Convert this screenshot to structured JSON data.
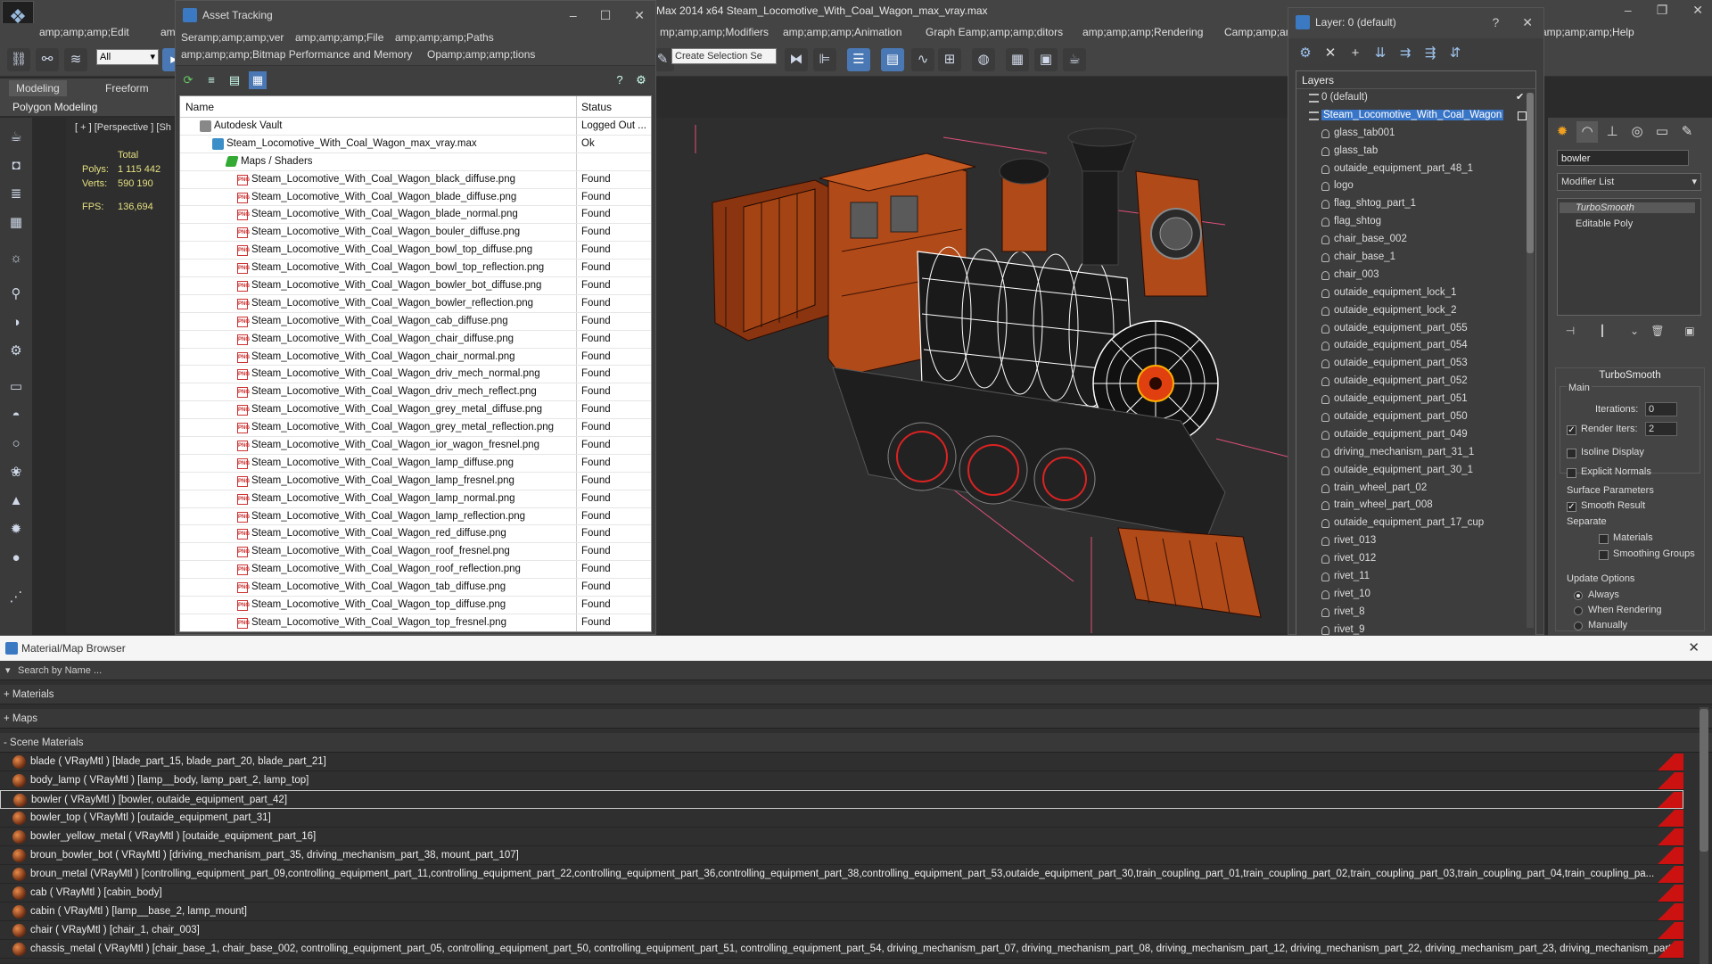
{
  "app": {
    "title": "Max  2014 x64     Steam_Locomotive_With_Coal_Wagon_max_vray.max",
    "logo": "max-logo",
    "window_controls": [
      "–",
      "❐",
      "✕"
    ]
  },
  "menubar": {
    "items": [
      "amp;amp;amp;Edit",
      "am",
      "mp;amp;amp;Modifiers",
      "amp;amp;amp;Animation",
      "Graph Eamp;amp;amp;ditors",
      "amp;amp;amp;Rendering",
      "Camp;amp;amp;ustomize",
      "amp;amp;amp;Help"
    ]
  },
  "toolbar": {
    "filter_value": "All",
    "selection_set_placeholder": "Create Selection Se"
  },
  "ribbon": {
    "tabs": [
      "Modeling",
      "Freeform"
    ],
    "subtitle": "Polygon Modeling"
  },
  "viewport": {
    "label": "[ + ] [Perspective ] [Sh",
    "stats": {
      "total_label": "Total",
      "polys_label": "Polys:",
      "polys_value": "1 115 442",
      "verts_label": "Verts:",
      "verts_value": "590 190",
      "fps_label": "FPS:",
      "fps_value": "136,694"
    }
  },
  "asset_tracking": {
    "title": "Asset Tracking",
    "menus": [
      "Seramp;amp;amp;ver",
      "amp;amp;amp;File",
      "amp;amp;amp;Paths",
      "amp;amp;amp;Bitmap Performance and Memory",
      "Opamp;amp;amp;tions"
    ],
    "columns": {
      "name": "Name",
      "status": "Status"
    },
    "rows": [
      {
        "name": "Autodesk Vault",
        "status": "Logged Out ...",
        "icon": "vault",
        "indent": 1
      },
      {
        "name": "Steam_Locomotive_With_Coal_Wagon_max_vray.max",
        "status": "Ok",
        "icon": "max",
        "indent": 2
      },
      {
        "name": "Maps / Shaders",
        "status": "",
        "icon": "maps",
        "indent": 3
      },
      {
        "name": "Steam_Locomotive_With_Coal_Wagon_black_diffuse.png",
        "status": "Found",
        "icon": "png",
        "indent": 4
      },
      {
        "name": "Steam_Locomotive_With_Coal_Wagon_blade_diffuse.png",
        "status": "Found",
        "icon": "png",
        "indent": 4
      },
      {
        "name": "Steam_Locomotive_With_Coal_Wagon_blade_normal.png",
        "status": "Found",
        "icon": "png",
        "indent": 4
      },
      {
        "name": "Steam_Locomotive_With_Coal_Wagon_bouler_diffuse.png",
        "status": "Found",
        "icon": "png",
        "indent": 4
      },
      {
        "name": "Steam_Locomotive_With_Coal_Wagon_bowl_top_diffuse.png",
        "status": "Found",
        "icon": "png",
        "indent": 4
      },
      {
        "name": "Steam_Locomotive_With_Coal_Wagon_bowl_top_reflection.png",
        "status": "Found",
        "icon": "png",
        "indent": 4
      },
      {
        "name": "Steam_Locomotive_With_Coal_Wagon_bowler_bot_diffuse.png",
        "status": "Found",
        "icon": "png",
        "indent": 4
      },
      {
        "name": "Steam_Locomotive_With_Coal_Wagon_bowler_reflection.png",
        "status": "Found",
        "icon": "png",
        "indent": 4
      },
      {
        "name": "Steam_Locomotive_With_Coal_Wagon_cab_diffuse.png",
        "status": "Found",
        "icon": "png",
        "indent": 4
      },
      {
        "name": "Steam_Locomotive_With_Coal_Wagon_chair_diffuse.png",
        "status": "Found",
        "icon": "png",
        "indent": 4
      },
      {
        "name": "Steam_Locomotive_With_Coal_Wagon_chair_normal.png",
        "status": "Found",
        "icon": "png",
        "indent": 4
      },
      {
        "name": "Steam_Locomotive_With_Coal_Wagon_driv_mech_normal.png",
        "status": "Found",
        "icon": "png",
        "indent": 4
      },
      {
        "name": "Steam_Locomotive_With_Coal_Wagon_driv_mech_reflect.png",
        "status": "Found",
        "icon": "png",
        "indent": 4
      },
      {
        "name": "Steam_Locomotive_With_Coal_Wagon_grey_metal_diffuse.png",
        "status": "Found",
        "icon": "png",
        "indent": 4
      },
      {
        "name": "Steam_Locomotive_With_Coal_Wagon_grey_metal_reflection.png",
        "status": "Found",
        "icon": "png",
        "indent": 4
      },
      {
        "name": "Steam_Locomotive_With_Coal_Wagon_ior_wagon_fresnel.png",
        "status": "Found",
        "icon": "png",
        "indent": 4
      },
      {
        "name": "Steam_Locomotive_With_Coal_Wagon_lamp_diffuse.png",
        "status": "Found",
        "icon": "png",
        "indent": 4
      },
      {
        "name": "Steam_Locomotive_With_Coal_Wagon_lamp_fresnel.png",
        "status": "Found",
        "icon": "png",
        "indent": 4
      },
      {
        "name": "Steam_Locomotive_With_Coal_Wagon_lamp_normal.png",
        "status": "Found",
        "icon": "png",
        "indent": 4
      },
      {
        "name": "Steam_Locomotive_With_Coal_Wagon_lamp_reflection.png",
        "status": "Found",
        "icon": "png",
        "indent": 4
      },
      {
        "name": "Steam_Locomotive_With_Coal_Wagon_red_diffuse.png",
        "status": "Found",
        "icon": "png",
        "indent": 4
      },
      {
        "name": "Steam_Locomotive_With_Coal_Wagon_roof_fresnel.png",
        "status": "Found",
        "icon": "png",
        "indent": 4
      },
      {
        "name": "Steam_Locomotive_With_Coal_Wagon_roof_reflection.png",
        "status": "Found",
        "icon": "png",
        "indent": 4
      },
      {
        "name": "Steam_Locomotive_With_Coal_Wagon_tab_diffuse.png",
        "status": "Found",
        "icon": "png",
        "indent": 4
      },
      {
        "name": "Steam_Locomotive_With_Coal_Wagon_top_diffuse.png",
        "status": "Found",
        "icon": "png",
        "indent": 4
      },
      {
        "name": "Steam_Locomotive_With_Coal_Wagon_top_fresnel.png",
        "status": "Found",
        "icon": "png",
        "indent": 4
      }
    ]
  },
  "layer_dialog": {
    "title": "Layer: 0 (default)",
    "help": "?",
    "panel_title": "Layers",
    "rows": [
      {
        "name": "0 (default)",
        "type": "layer",
        "indent": 1,
        "check": "✔"
      },
      {
        "name": "Steam_Locomotive_With_Coal_Wagon",
        "type": "layer",
        "indent": 1,
        "selected": true
      },
      {
        "name": "glass_tab001",
        "type": "object",
        "indent": 2
      },
      {
        "name": "glass_tab",
        "type": "object",
        "indent": 2
      },
      {
        "name": "outaide_equipment_part_48_1",
        "type": "object",
        "indent": 2
      },
      {
        "name": "logo",
        "type": "object",
        "indent": 2
      },
      {
        "name": "flag_shtog_part_1",
        "type": "object",
        "indent": 2
      },
      {
        "name": "flag_shtog",
        "type": "object",
        "indent": 2
      },
      {
        "name": "chair_base_002",
        "type": "object",
        "indent": 2
      },
      {
        "name": "chair_base_1",
        "type": "object",
        "indent": 2
      },
      {
        "name": "chair_003",
        "type": "object",
        "indent": 2
      },
      {
        "name": "outaide_equipment_lock_1",
        "type": "object",
        "indent": 2
      },
      {
        "name": "outaide_equipment_lock_2",
        "type": "object",
        "indent": 2
      },
      {
        "name": "outaide_equipment_part_055",
        "type": "object",
        "indent": 2
      },
      {
        "name": "outaide_equipment_part_054",
        "type": "object",
        "indent": 2
      },
      {
        "name": "outaide_equipment_part_053",
        "type": "object",
        "indent": 2
      },
      {
        "name": "outaide_equipment_part_052",
        "type": "object",
        "indent": 2
      },
      {
        "name": "outaide_equipment_part_051",
        "type": "object",
        "indent": 2
      },
      {
        "name": "outaide_equipment_part_050",
        "type": "object",
        "indent": 2
      },
      {
        "name": "outaide_equipment_part_049",
        "type": "object",
        "indent": 2
      },
      {
        "name": "driving_mechanism_part_31_1",
        "type": "object",
        "indent": 2
      },
      {
        "name": "outaide_equipment_part_30_1",
        "type": "object",
        "indent": 2
      },
      {
        "name": "train_wheel_part_02",
        "type": "object",
        "indent": 2
      },
      {
        "name": "train_wheel_part_008",
        "type": "object",
        "indent": 2
      },
      {
        "name": "outaide_equipment_part_17_cup",
        "type": "object",
        "indent": 2
      },
      {
        "name": "rivet_013",
        "type": "object",
        "indent": 2
      },
      {
        "name": "rivet_012",
        "type": "object",
        "indent": 2
      },
      {
        "name": "rivet_11",
        "type": "object",
        "indent": 2
      },
      {
        "name": "rivet_10",
        "type": "object",
        "indent": 2
      },
      {
        "name": "rivet_8",
        "type": "object",
        "indent": 2
      },
      {
        "name": "rivet_9",
        "type": "object",
        "indent": 2
      }
    ]
  },
  "command_panel": {
    "object_name": "bowler",
    "modifier_list": "Modifier List",
    "stack": [
      "TurboSmooth",
      "Editable Poly"
    ],
    "turbosmooth": {
      "title": "TurboSmooth",
      "main_label": "Main",
      "iterations_label": "Iterations:",
      "iterations_value": "0",
      "render_iters_label": "Render Iters:",
      "render_iters_value": "2",
      "isoline_label": "Isoline Display",
      "explicit_label": "Explicit Normals",
      "surface_label": "Surface Parameters",
      "smooth_result_label": "Smooth Result",
      "separate_label": "Separate",
      "materials_label": "Materials",
      "smoothing_groups_label": "Smoothing Groups",
      "update_label": "Update Options",
      "always_label": "Always",
      "when_rendering_label": "When Rendering",
      "manually_label": "Manually"
    }
  },
  "material_browser": {
    "title": "Material/Map Browser",
    "search_placeholder": "Search by Name ...",
    "sections": [
      "+ Materials",
      "+ Maps",
      "- Scene Materials"
    ],
    "materials": [
      "blade  ( VRayMtl ) [blade_part_15, blade_part_20, blade_part_21]",
      "body_lamp  ( VRayMtl ) [lamp__body, lamp_part_2, lamp_top]",
      "bowler  ( VRayMtl ) [bowler, outaide_equipment_part_42]",
      "bowler_top  ( VRayMtl ) [outaide_equipment_part_31]",
      "bowler_yellow_metal  ( VRayMtl ) [outaide_equipment_part_16]",
      "broun_bowler_bot  ( VRayMtl ) [driving_mechanism_part_35, driving_mechanism_part_38, mount_part_107]",
      "broun_metal  (VRayMtl ) [controlling_equipment_part_09,controlling_equipment_part_11,controlling_equipment_part_22,controlling_equipment_part_36,controlling_equipment_part_38,controlling_equipment_part_53,outaide_equipment_part_30,train_coupling_part_01,train_coupling_part_02,train_coupling_part_03,train_coupling_part_04,train_coupling_pa...",
      "cab  ( VRayMtl ) [cabin_body]",
      "cabin  ( VRayMtl ) [lamp__base_2, lamp_mount]",
      "chair  ( VRayMtl ) [chair_1, chair_003]",
      "chassis_metal  ( VRayMtl ) [chair_base_1, chair_base_002, controlling_equipment_part_05, controlling_equipment_part_50, controlling_equipment_part_51, controlling_equipment_part_54, driving_mechanism_part_07, driving_mechanism_part_08, driving_mechanism_part_12, driving_mechanism_part_22, driving_mechanism_part_23, driving_mechanism_part_24,..."
    ],
    "selected_index": 2
  },
  "colors": {
    "accent": "#3975c7",
    "loco_orange": "#b8501a",
    "wire_white": "#ffffff",
    "bbox_pink": "#e0507a"
  }
}
